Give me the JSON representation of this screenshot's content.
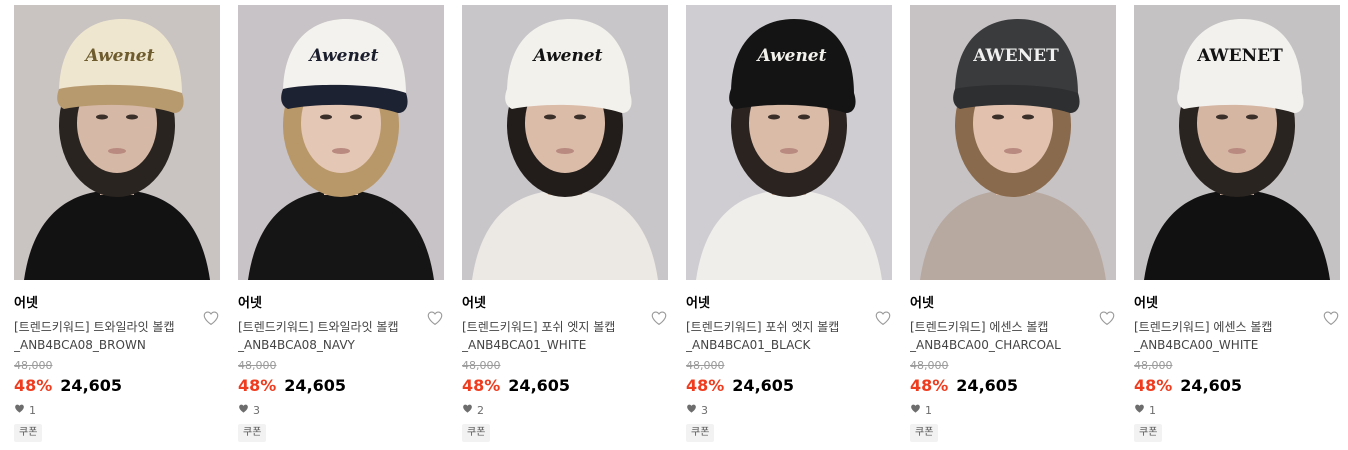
{
  "products": [
    {
      "brand": "어넷",
      "name": "[트렌드키워드] 트와일라잇 볼캡\n_ANB4BCA08_BROWN",
      "original_price": "48,000",
      "discount": "48%",
      "sale_price": "24,605",
      "likes": "1",
      "coupon": "쿠폰",
      "image": {
        "bg": "#c9c3c2",
        "cap": "#efe6cf",
        "brim": "#b89a6f",
        "logo": "Awenet",
        "logo_color": "#6e5c2e",
        "top": "#121212",
        "hair": "#2a2420",
        "skin": "#d6b8a6"
      }
    },
    {
      "brand": "어넷",
      "name": "[트렌드키워드] 트와일라잇 볼캡\n_ANB4BCA08_NAVY",
      "original_price": "48,000",
      "discount": "48%",
      "sale_price": "24,605",
      "likes": "3",
      "coupon": "쿠폰",
      "image": {
        "bg": "#c8c3c6",
        "cap": "#f4f2ee",
        "brim": "#1d2233",
        "logo": "Awenet",
        "logo_color": "#1b1e2c",
        "top": "#151515",
        "hair": "#b89868",
        "skin": "#e4c7b5"
      }
    },
    {
      "brand": "어넷",
      "name": "[트렌드키워드] 포쉬 엣지 볼캡\n_ANB4BCA01_WHITE",
      "original_price": "48,000",
      "discount": "48%",
      "sale_price": "24,605",
      "likes": "2",
      "coupon": "쿠폰",
      "image": {
        "bg": "#c8c6c9",
        "cap": "#f3f1ec",
        "brim": "#f3f1ec",
        "logo": "Awenet",
        "logo_color": "#121212",
        "top": "#ece8e4",
        "hair": "#221d1a",
        "skin": "#dbbca9"
      }
    },
    {
      "brand": "어넷",
      "name": "[트렌드키워드] 포쉬 엣지 볼캡\n_ANB4BCA01_BLACK",
      "original_price": "48,000",
      "discount": "48%",
      "sale_price": "24,605",
      "likes": "3",
      "coupon": "쿠폰",
      "image": {
        "bg": "#cfcdd1",
        "cap": "#141414",
        "brim": "#141414",
        "logo": "Awenet",
        "logo_color": "#f3f1ec",
        "top": "#f0eeeb",
        "hair": "#2a2320",
        "skin": "#d9bba8"
      }
    },
    {
      "brand": "어넷",
      "name": "[트렌드키워드] 에센스 볼캡\n_ANB4BCA00_CHARCOAL",
      "original_price": "48,000",
      "discount": "48%",
      "sale_price": "24,605",
      "likes": "1",
      "coupon": "쿠폰",
      "image": {
        "bg": "#c7c3c5",
        "cap": "#3a3b3d",
        "brim": "#2e2f31",
        "logo": "AWENET",
        "logo_color": "#f0f0f0",
        "top": "#b7a9a0",
        "hair": "#8a6a4c",
        "skin": "#e2c2ae"
      }
    },
    {
      "brand": "어넷",
      "name": "[트렌드키워드] 에센스 볼캡\n_ANB4BCA00_WHITE",
      "original_price": "48,000",
      "discount": "48%",
      "sale_price": "24,605",
      "likes": "1",
      "coupon": "쿠폰",
      "image": {
        "bg": "#c5c2c3",
        "cap": "#f3f1ee",
        "brim": "#f3f1ee",
        "logo": "AWENET",
        "logo_color": "#121212",
        "top": "#111111",
        "hair": "#2a2420",
        "skin": "#d4b6a3"
      }
    }
  ],
  "icons": {
    "heart": "heart-outline-icon",
    "like": "heart-filled-icon"
  },
  "colors": {
    "discount": "#f03c1e",
    "muted": "#9b9b9b"
  }
}
